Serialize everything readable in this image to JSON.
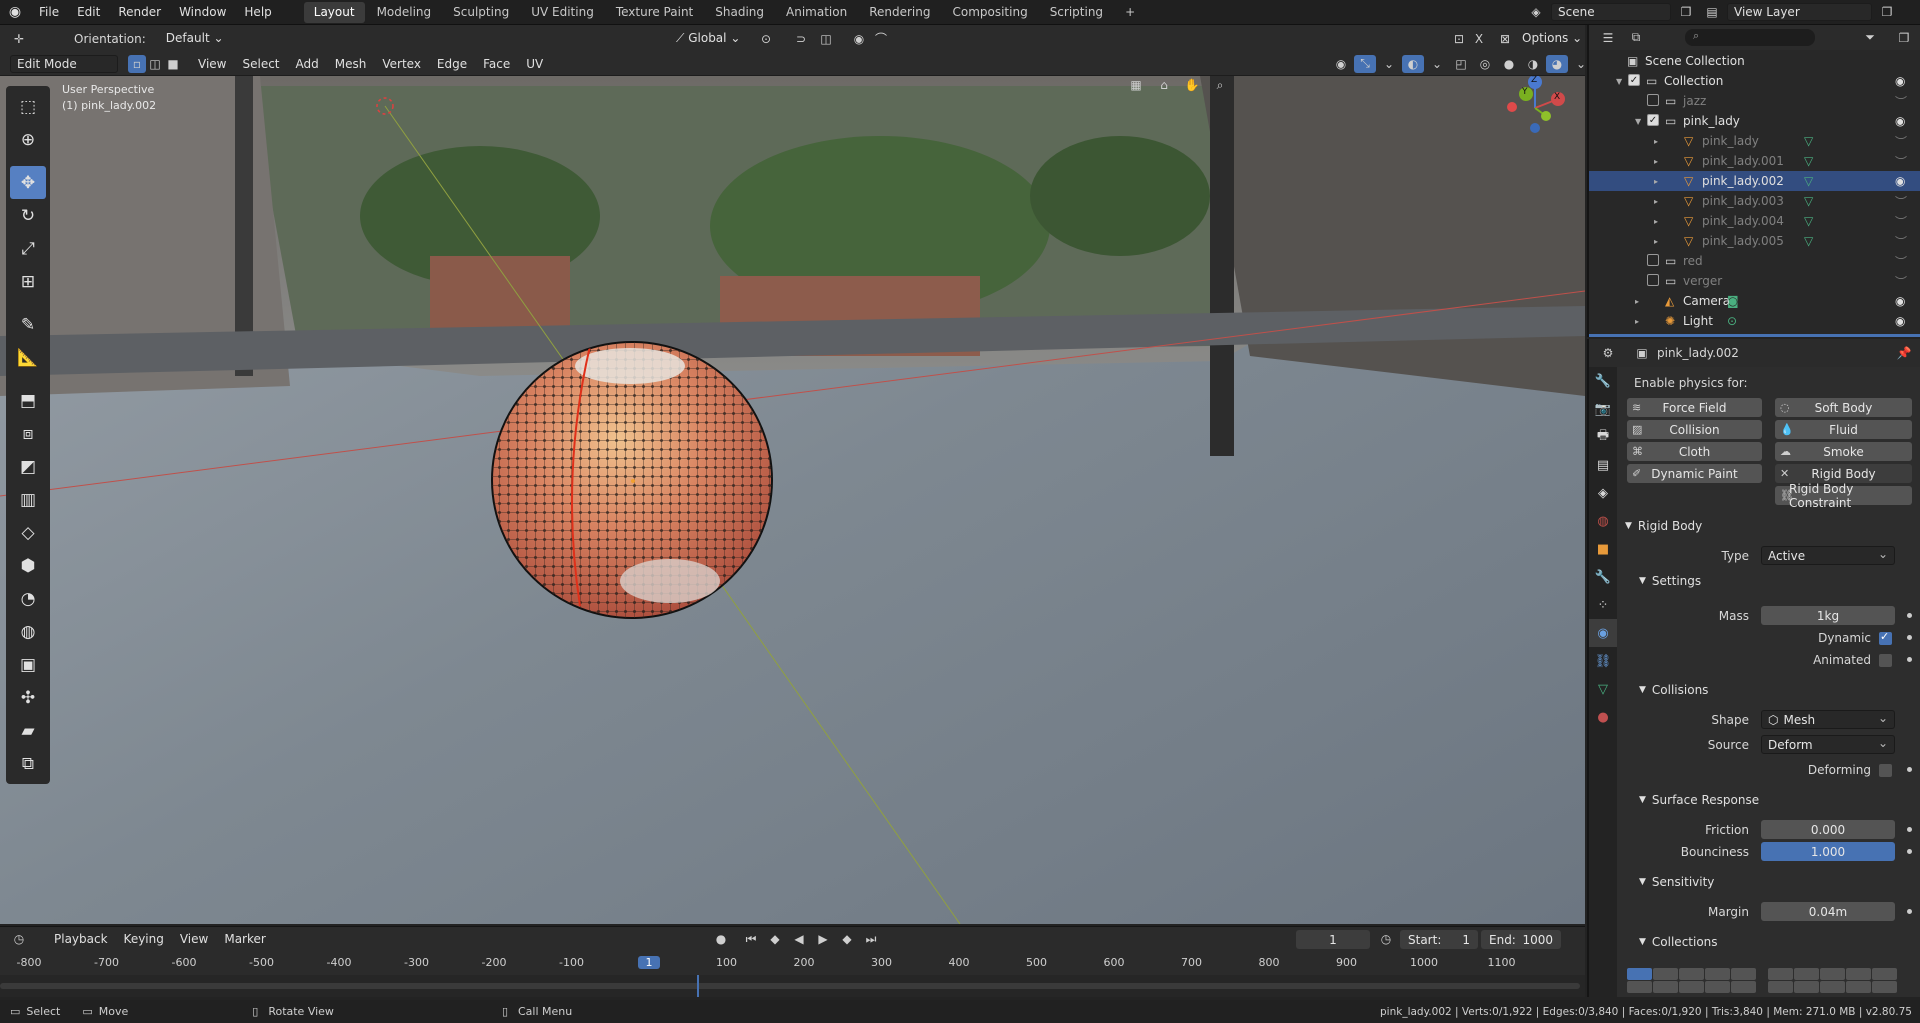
{
  "top_menu": {
    "items": [
      "File",
      "Edit",
      "Render",
      "Window",
      "Help"
    ],
    "workspaces": [
      "Layout",
      "Modeling",
      "Sculpting",
      "UV Editing",
      "Texture Paint",
      "Shading",
      "Animation",
      "Rendering",
      "Compositing",
      "Scripting"
    ],
    "active_workspace": "Layout",
    "scene": "Scene",
    "view_layer": "View Layer"
  },
  "tool_header": {
    "orientation_label": "Orientation:",
    "orientation_value": "Default",
    "transform_orientation": "Global",
    "options": "Options"
  },
  "viewport_header": {
    "mode": "Edit Mode",
    "menus": [
      "View",
      "Select",
      "Add",
      "Mesh",
      "Vertex",
      "Edge",
      "Face",
      "UV"
    ]
  },
  "viewport": {
    "perspective_label": "User Perspective",
    "object_label": "(1) pink_lady.002",
    "gizmo_axes": [
      "X",
      "Y",
      "Z"
    ]
  },
  "outliner": {
    "rows": [
      {
        "name": "Scene Collection",
        "depth": 0,
        "kind": "scene",
        "eye": false,
        "checked": null,
        "dim": false
      },
      {
        "name": "Collection",
        "depth": 1,
        "kind": "collection",
        "eye": true,
        "checked": true,
        "dim": false
      },
      {
        "name": "jazz",
        "depth": 2,
        "kind": "collection",
        "eye": false,
        "checked": false,
        "dim": true
      },
      {
        "name": "pink_lady",
        "depth": 2,
        "kind": "collection",
        "eye": true,
        "checked": true,
        "dim": false
      },
      {
        "name": "pink_lady",
        "depth": 3,
        "kind": "mesh",
        "eye": false,
        "checked": null,
        "dim": true
      },
      {
        "name": "pink_lady.001",
        "depth": 3,
        "kind": "mesh",
        "eye": false,
        "checked": null,
        "dim": true
      },
      {
        "name": "pink_lady.002",
        "depth": 3,
        "kind": "mesh",
        "eye": true,
        "checked": null,
        "dim": false
      },
      {
        "name": "pink_lady.003",
        "depth": 3,
        "kind": "mesh",
        "eye": false,
        "checked": null,
        "dim": true
      },
      {
        "name": "pink_lady.004",
        "depth": 3,
        "kind": "mesh",
        "eye": false,
        "checked": null,
        "dim": true
      },
      {
        "name": "pink_lady.005",
        "depth": 3,
        "kind": "mesh",
        "eye": false,
        "checked": null,
        "dim": true
      },
      {
        "name": "red",
        "depth": 2,
        "kind": "collection",
        "eye": false,
        "checked": false,
        "dim": true
      },
      {
        "name": "verger",
        "depth": 2,
        "kind": "collection",
        "eye": false,
        "checked": false,
        "dim": true
      },
      {
        "name": "Camera",
        "depth": 2,
        "kind": "camera",
        "eye": true,
        "checked": null,
        "dim": false
      },
      {
        "name": "Light",
        "depth": 2,
        "kind": "light",
        "eye": true,
        "checked": null,
        "dim": false
      }
    ]
  },
  "properties": {
    "object_name": "pink_lady.002",
    "enable_physics_label": "Enable physics for:",
    "physics_buttons_left": [
      "Force Field",
      "Collision",
      "Cloth",
      "Dynamic Paint"
    ],
    "physics_buttons_right": [
      "Soft Body",
      "Fluid",
      "Smoke",
      "Rigid Body",
      "Rigid Body Constraint"
    ],
    "rigid_body_title": "Rigid Body",
    "type_label": "Type",
    "type_value": "Active",
    "settings_title": "Settings",
    "mass_label": "Mass",
    "mass_value": "1kg",
    "dynamic_label": "Dynamic",
    "dynamic_checked": true,
    "animated_label": "Animated",
    "animated_checked": false,
    "collisions_title": "Collisions",
    "shape_label": "Shape",
    "shape_value": "Mesh",
    "source_label": "Source",
    "source_value": "Deform",
    "deforming_label": "Deforming",
    "deforming_checked": false,
    "surface_response_title": "Surface Response",
    "friction_label": "Friction",
    "friction_value": "0.000",
    "bounciness_label": "Bounciness",
    "bounciness_value": "1.000",
    "sensitivity_title": "Sensitivity",
    "margin_label": "Margin",
    "margin_value": "0.04m",
    "collections_title": "Collections"
  },
  "timeline": {
    "menus": [
      "Playback",
      "Keying",
      "View",
      "Marker"
    ],
    "current_frame": "1",
    "start_label": "Start:",
    "start_value": "1",
    "end_label": "End:",
    "end_value": "1000",
    "ruler_ticks": [
      "-800",
      "-700",
      "-600",
      "-500",
      "-400",
      "-300",
      "-200",
      "-100",
      "1",
      "100",
      "200",
      "300",
      "400",
      "500",
      "600",
      "700",
      "800",
      "900",
      "1000",
      "1100"
    ]
  },
  "statusbar": {
    "select": "Select",
    "move": "Move",
    "rotate": "Rotate View",
    "call_menu": "Call Menu",
    "stats": "pink_lady.002 | Verts:0/1,922 | Edges:0/3,840 | Faces:0/1,920 | Tris:3,840 | Mem: 271.0 MB | v2.80.75"
  },
  "colors": {
    "accent": "#4772b3",
    "active_tool": "#5680c2",
    "panel_bg": "#2d2d2d",
    "header_bg": "#2b2b2b"
  }
}
